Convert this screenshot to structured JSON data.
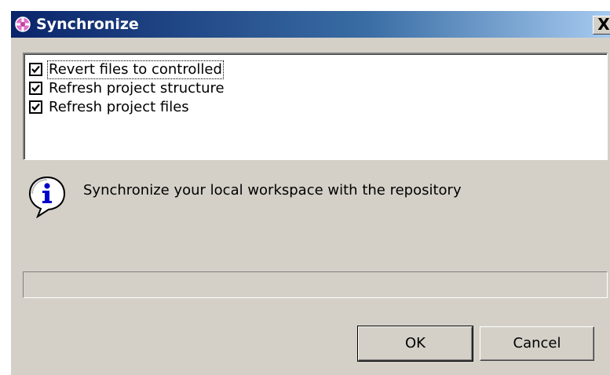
{
  "window": {
    "title": "Synchronize",
    "icon": "synchronize-app-icon",
    "close_label": "X"
  },
  "options": [
    {
      "label": "Revert files to controlled",
      "checked": true,
      "focused": true
    },
    {
      "label": "Refresh project structure",
      "checked": true,
      "focused": false
    },
    {
      "label": "Refresh project files",
      "checked": true,
      "focused": false
    }
  ],
  "info": {
    "icon": "info-icon",
    "message": "Synchronize your local workspace with the repository"
  },
  "progress": {
    "value": 0
  },
  "buttons": {
    "ok_label": "OK",
    "cancel_label": "Cancel"
  },
  "colors": {
    "dialog_bg": "#d4d0c8",
    "titlebar_start": "#0a246a",
    "titlebar_end": "#a6caf0",
    "info_icon_blue": "#0000cc"
  }
}
